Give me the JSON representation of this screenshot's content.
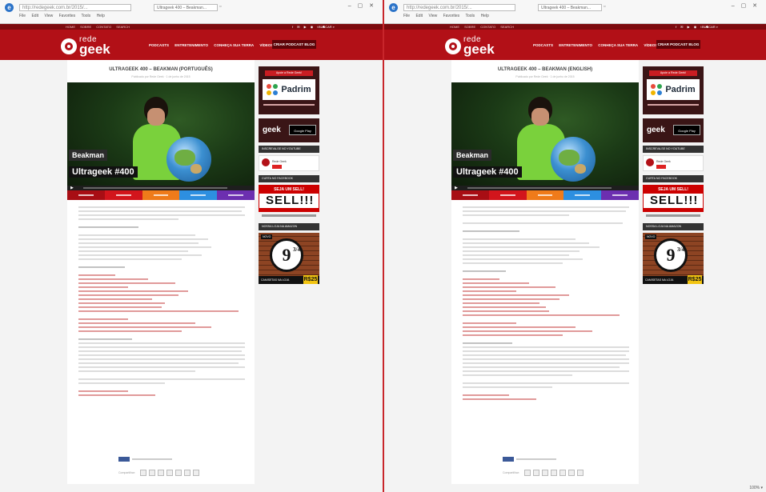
{
  "browser": {
    "address": "http://redegeek.com.br/2015/...",
    "tab_title": "Ultrageek 400 – Beakman...",
    "menu": [
      "File",
      "Edit",
      "View",
      "Favorites",
      "Tools",
      "Help"
    ],
    "window_controls": "– ▢ ✕"
  },
  "site": {
    "brand_line1": "rede",
    "brand_line2": "geek",
    "top_links": [
      "HOME",
      "SOBRE",
      "CONTATO",
      "SEARCH"
    ],
    "social": "f ✉ ▶ ◉ t ✱",
    "search_label": "BUSCAR  ⌕",
    "nav": [
      "PODCASTS",
      "ENTRETENIMENTO",
      "CONHEÇA SUA TERRA",
      "VÍDEOS",
      "VIAGENS"
    ],
    "nav_button": "CRIAR  PODCAST  BLOG"
  },
  "left": {
    "title": "ULTRAGEEK 400 – BEAKMAN (PORTUGUÊS)",
    "meta": "Publicado por Rede Geek · 1 de junho de 2015",
    "hero_caption1": "Beakman",
    "hero_caption2": "Ultrageek #400"
  },
  "right": {
    "title": "ULTRAGEEK 400 – BEAKMAN (ENGLISH)",
    "meta": "Publicado por Rede Geek · 1 de junho de 2015",
    "hero_caption1": "Beakman",
    "hero_caption2": "Ultrageek #400"
  },
  "sidebar": {
    "padrim_header": "Apoie a Rede Geek!",
    "padrim_name": "Padrim",
    "gplay_brand": "geek",
    "gplay_badge": "Google Play",
    "youtube_header": "INSCREVA-SE NO YOUTUBE",
    "youtube_channel": "Rede Geek",
    "facebook_header": "CURTA NO FACEBOOK",
    "facebook_banner_top": "SEJA UM SELL!",
    "facebook_banner_big": "SELL!!!",
    "shop_header": "NOSSA LOJA NA AMAZON",
    "shop_tag": "NOVO",
    "shop_number": "9",
    "shop_fraction": "3/4",
    "shop_strip": "CAMISETAS NA LOJA",
    "shop_price": "R$25"
  },
  "pager_label": "Compartilhar:",
  "status_right": "100% ▾"
}
